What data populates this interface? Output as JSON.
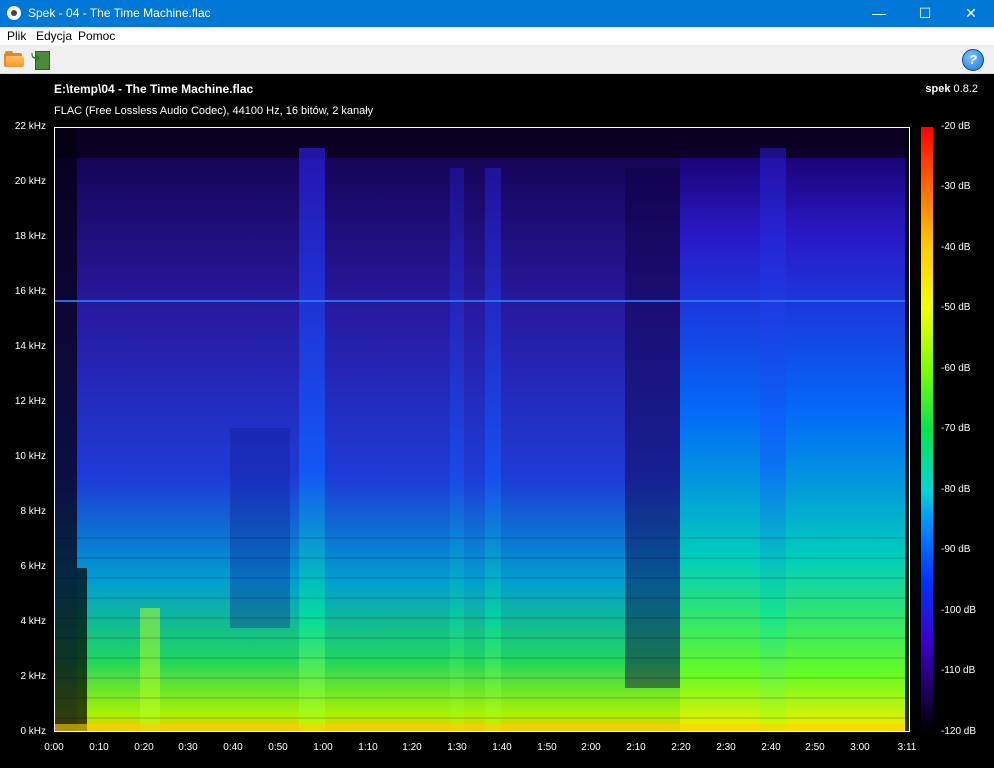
{
  "window": {
    "title": "Spek - 04 - The Time Machine.flac",
    "minimize_icon": "minimize-icon",
    "maximize_icon": "maximize-icon",
    "close_icon": "close-icon"
  },
  "menu": {
    "items": [
      {
        "label": "Plik"
      },
      {
        "label": "Edycja"
      },
      {
        "label": "Pomoc"
      }
    ]
  },
  "toolbar": {
    "open_icon": "folder-open-icon",
    "save_icon": "save-icon",
    "help_icon": "help-icon"
  },
  "spectrogram": {
    "file_title": "E:\\temp\\04 - The Time Machine.flac",
    "file_info": "FLAC (Free Lossless Audio Codec), 44100 Hz, 16 bitów, 2 kanały",
    "brand": "spek",
    "version": "0.8.2",
    "freq_labels": [
      "22 kHz",
      "20 kHz",
      "18 kHz",
      "16 kHz",
      "14 kHz",
      "12 kHz",
      "10 kHz",
      "8 kHz",
      "6 kHz",
      "4 kHz",
      "2 kHz",
      "0 kHz"
    ],
    "time_labels": [
      "0:00",
      "0:10",
      "0:20",
      "0:30",
      "0:40",
      "0:50",
      "1:00",
      "1:10",
      "1:20",
      "1:30",
      "1:40",
      "1:50",
      "2:00",
      "2:10",
      "2:20",
      "2:30",
      "2:40",
      "2:50",
      "3:00",
      "3:11"
    ],
    "db_labels": [
      "-20 dB",
      "-30 dB",
      "-40 dB",
      "-50 dB",
      "-60 dB",
      "-70 dB",
      "-80 dB",
      "-90 dB",
      "-100 dB",
      "-110 dB",
      "-120 dB"
    ],
    "colors": {
      "background": "#000000",
      "frame": "#ffffff",
      "titlebar": "#0078d7"
    }
  }
}
